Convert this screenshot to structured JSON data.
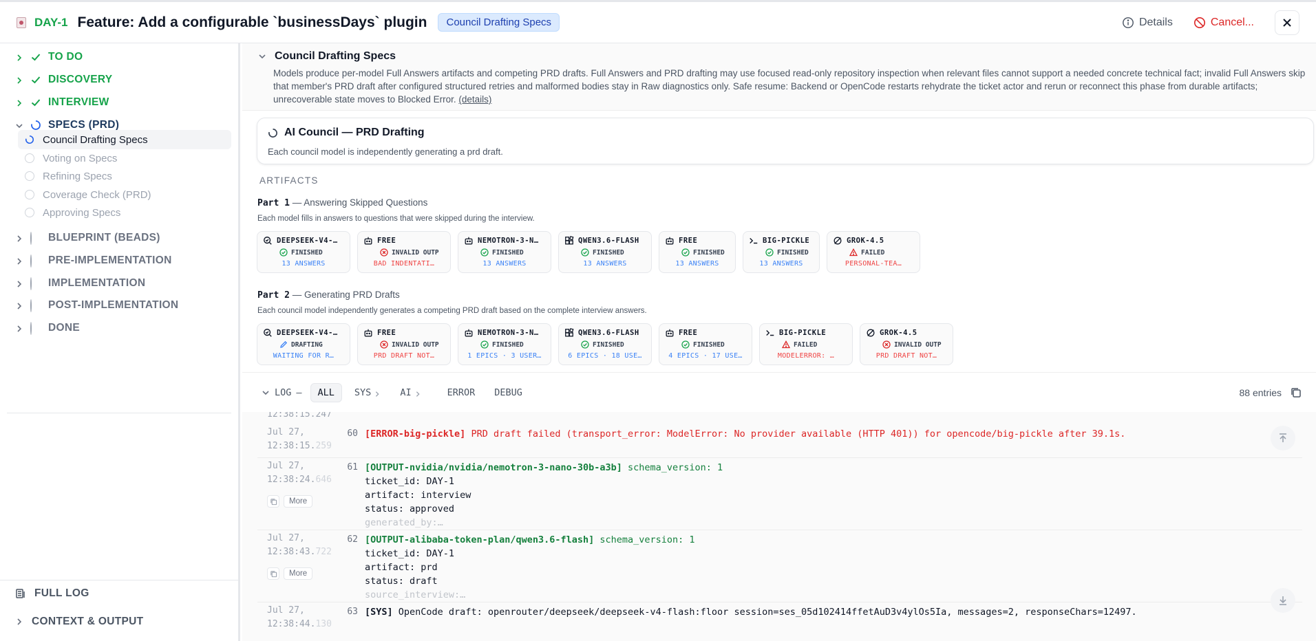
{
  "header": {
    "ticket_id": "DAY-1",
    "title": "Feature: Add a configurable `businessDays` plugin",
    "badge": "Council Drafting Specs",
    "details_label": "Details",
    "cancel_label": "Cancel..."
  },
  "sidebar": {
    "phases": [
      {
        "label": "TO DO",
        "status": "done"
      },
      {
        "label": "DISCOVERY",
        "status": "done"
      },
      {
        "label": "INTERVIEW",
        "status": "done"
      },
      {
        "label": "SPECS (PRD)",
        "status": "active"
      },
      {
        "label": "BLUEPRINT (BEADS)",
        "status": "pending"
      },
      {
        "label": "PRE-IMPLEMENTATION",
        "status": "pending"
      },
      {
        "label": "IMPLEMENTATION",
        "status": "pending"
      },
      {
        "label": "POST-IMPLEMENTATION",
        "status": "pending"
      },
      {
        "label": "DONE",
        "status": "pending"
      }
    ],
    "sub_items": [
      {
        "label": "Council Drafting Specs",
        "status": "active"
      },
      {
        "label": "Voting on Specs",
        "status": "pending"
      },
      {
        "label": "Refining Specs",
        "status": "pending"
      },
      {
        "label": "Coverage Check (PRD)",
        "status": "pending"
      },
      {
        "label": "Approving Specs",
        "status": "pending"
      }
    ],
    "footer": {
      "full_log": "FULL LOG",
      "context_output": "CONTEXT & OUTPUT"
    }
  },
  "stage": {
    "title": "Council Drafting Specs",
    "description": "Models produce per-model Full Answers artifacts and competing PRD drafts. Full Answers and PRD drafting may use focused read-only repository inspection when relevant files cannot support a needed concrete technical fact; invalid Full Answers skip that member's PRD draft after configured structured retries and malformed bodies stay in Raw diagnostics only. Safe resume: Backend or OpenCode restarts rehydrate the ticket actor and rerun or reconnect this phase from durable artifacts; unrecoverable state moves to Blocked Error.",
    "details_link": "(details)"
  },
  "council": {
    "title": "AI Council — PRD Drafting",
    "description": "Each council model is independently generating a prd draft."
  },
  "artifacts": {
    "label": "ARTIFACTS",
    "part1": {
      "num": "Part 1",
      "title": "— Answering Skipped Questions",
      "description": "Each model fills in answers to questions that were skipped during the interview.",
      "cards": [
        {
          "name": "DEEPSEEK-V4-…",
          "icon": "search-icon",
          "status": "FINISHED",
          "status_kind": "ok",
          "detail": "13 ANSWERS",
          "detail_kind": "blue"
        },
        {
          "name": "FREE",
          "icon": "robot-icon",
          "status": "INVALID OUTP",
          "status_kind": "error",
          "detail": "BAD INDENTATI…",
          "detail_kind": "red"
        },
        {
          "name": "NEMOTRON-3-N…",
          "icon": "robot-icon",
          "status": "FINISHED",
          "status_kind": "ok",
          "detail": "13 ANSWERS",
          "detail_kind": "blue"
        },
        {
          "name": "QWEN3.6-FLASH",
          "icon": "blocks-icon",
          "status": "FINISHED",
          "status_kind": "ok",
          "detail": "13 ANSWERS",
          "detail_kind": "blue"
        },
        {
          "name": "FREE",
          "icon": "robot-icon",
          "status": "FINISHED",
          "status_kind": "ok",
          "detail": "13 ANSWERS",
          "detail_kind": "blue"
        },
        {
          "name": "BIG-PICKLE",
          "icon": "terminal-icon",
          "status": "FINISHED",
          "status_kind": "ok",
          "detail": "13 ANSWERS",
          "detail_kind": "blue"
        },
        {
          "name": "GROK-4.5",
          "icon": "grok-icon",
          "status": "FAILED",
          "status_kind": "warn",
          "detail": "PERSONAL-TEA…",
          "detail_kind": "red"
        }
      ]
    },
    "part2": {
      "num": "Part 2",
      "title": "— Generating PRD Drafts",
      "description": "Each council model independently generates a competing PRD draft based on the complete interview answers.",
      "cards": [
        {
          "name": "DEEPSEEK-V4-…",
          "icon": "search-icon",
          "status": "DRAFTING",
          "status_kind": "drafting",
          "detail": "WAITING FOR R…",
          "detail_kind": "blue"
        },
        {
          "name": "FREE",
          "icon": "robot-icon",
          "status": "INVALID OUTP",
          "status_kind": "error",
          "detail": "PRD DRAFT NOT…",
          "detail_kind": "red"
        },
        {
          "name": "NEMOTRON-3-N…",
          "icon": "robot-icon",
          "status": "FINISHED",
          "status_kind": "ok",
          "detail": "1 EPICS · 3 USER…",
          "detail_kind": "blue"
        },
        {
          "name": "QWEN3.6-FLASH",
          "icon": "blocks-icon",
          "status": "FINISHED",
          "status_kind": "ok",
          "detail": "6 EPICS · 18 USE…",
          "detail_kind": "blue"
        },
        {
          "name": "FREE",
          "icon": "robot-icon",
          "status": "FINISHED",
          "status_kind": "ok",
          "detail": "4 EPICS · 17 USE…",
          "detail_kind": "blue"
        },
        {
          "name": "BIG-PICKLE",
          "icon": "terminal-icon",
          "status": "FAILED",
          "status_kind": "warn",
          "detail": "MODELERROR: …",
          "detail_kind": "red"
        },
        {
          "name": "GROK-4.5",
          "icon": "grok-icon",
          "status": "INVALID OUTP",
          "status_kind": "error",
          "detail": "PRD DRAFT NOT…",
          "detail_kind": "red"
        }
      ]
    }
  },
  "log": {
    "title": "LOG",
    "filters": [
      "ALL",
      "SYS",
      "AI",
      "ERROR",
      "DEBUG"
    ],
    "active_filter": "ALL",
    "count": "88 entries",
    "more_label": "More",
    "top_partial_ts": "12:38:15.247",
    "entries": [
      {
        "date": "Jul 27,",
        "time": "12:38:15.",
        "ms": "259",
        "num": "60",
        "tag": "[ERROR-big-pickle]",
        "kind": "error",
        "lines": [
          "PRD draft failed (transport_error: ModelError: No provider available (HTTP 401)) for opencode/big-pickle after 39.1s."
        ]
      },
      {
        "date": "Jul 27,",
        "time": "12:38:24.",
        "ms": "646",
        "num": "61",
        "tag": "[OUTPUT-nvidia/nvidia/nemotron-3-nano-30b-a3b]",
        "kind": "output",
        "lines": [
          "schema_version: 1",
          "ticket_id: DAY-1",
          "artifact: interview",
          "status: approved",
          "generated_by:…"
        ]
      },
      {
        "date": "Jul 27,",
        "time": "12:38:43.",
        "ms": "722",
        "num": "62",
        "tag": "[OUTPUT-alibaba-token-plan/qwen3.6-flash]",
        "kind": "output",
        "lines": [
          "schema_version: 1",
          "ticket_id: DAY-1",
          "artifact: prd",
          "status: draft",
          "source_interview:…"
        ]
      },
      {
        "date": "Jul 27,",
        "time": "12:38:44.",
        "ms": "130",
        "num": "63",
        "tag": "[SYS]",
        "kind": "sys",
        "lines": [
          "OpenCode draft: openrouter/deepseek/deepseek-v4-flash:floor session=ses_05d102414ffetAuD3v4ylOs5Ia, messages=2, responseChars=12497."
        ]
      }
    ]
  },
  "colors": {
    "success": "#16a34a",
    "error": "#dc2626",
    "accent": "#3b82f6",
    "badge_bg": "#dbeafe"
  }
}
